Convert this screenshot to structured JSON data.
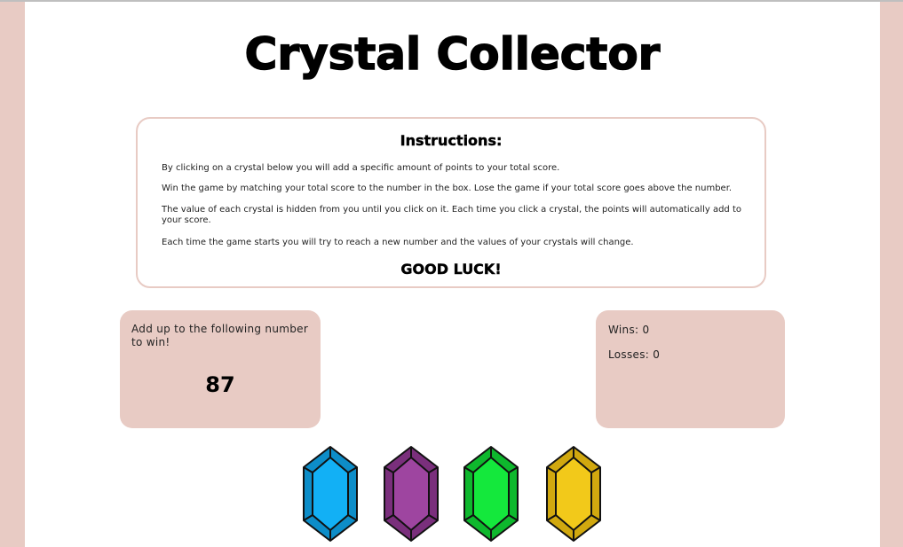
{
  "title": "Crystal Collector",
  "instructions": {
    "heading": "Instructions:",
    "paragraphs": [
      "By clicking on a crystal below you will add a specific amount of points to your total score.",
      "Win the game by matching your total score to the number in the box. Lose the game if your total score goes above the number.",
      "The value of each crystal is hidden from you until you click on it. Each time you click a crystal, the points will automatically add to your score.",
      "Each time the game starts you will try to reach a new number and the values of your crystals will change."
    ],
    "closing": "GOOD LUCK!"
  },
  "target": {
    "label": "Add up to the following number to win!",
    "number": "87"
  },
  "stats": {
    "wins": "Wins: 0",
    "losses": "Losses: 0"
  },
  "crystals": [
    {
      "name": "blue-crystal",
      "color": "#12b0f5",
      "dark": "#0d8dc8"
    },
    {
      "name": "purple-crystal",
      "color": "#9e45a0",
      "dark": "#7a2f7c"
    },
    {
      "name": "green-crystal",
      "color": "#14e83c",
      "dark": "#0eb82d"
    },
    {
      "name": "yellow-crystal",
      "color": "#f2c91a",
      "dark": "#d1a80f"
    }
  ],
  "colors": {
    "background": "#e8cbc4",
    "panel": "#e8cbc4"
  }
}
